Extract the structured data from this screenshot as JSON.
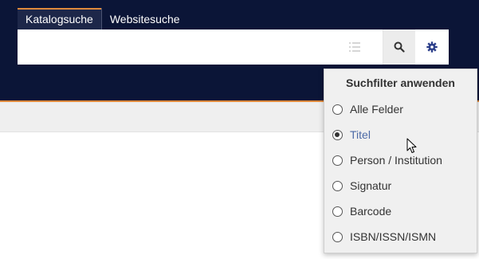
{
  "tabs": [
    {
      "label": "Katalogsuche",
      "active": true
    },
    {
      "label": "Websitesuche",
      "active": false
    }
  ],
  "search": {
    "value": "",
    "placeholder": "",
    "icons": [
      "list-icon",
      "search-icon",
      "gear-icon"
    ]
  },
  "filter_menu": {
    "title": "Suchfilter anwenden",
    "options": [
      {
        "label": "Alle Felder",
        "checked": false
      },
      {
        "label": "Titel",
        "checked": true
      },
      {
        "label": "Person / Institution",
        "checked": false
      },
      {
        "label": "Signatur",
        "checked": false
      },
      {
        "label": "Barcode",
        "checked": false
      },
      {
        "label": "ISBN/ISSN/ISMN",
        "checked": false
      }
    ]
  },
  "colors": {
    "header_bg": "#0b1537",
    "accent": "#e08a3c",
    "gear_icon": "#2c3f8a",
    "selected_text": "#4c6aa6"
  }
}
